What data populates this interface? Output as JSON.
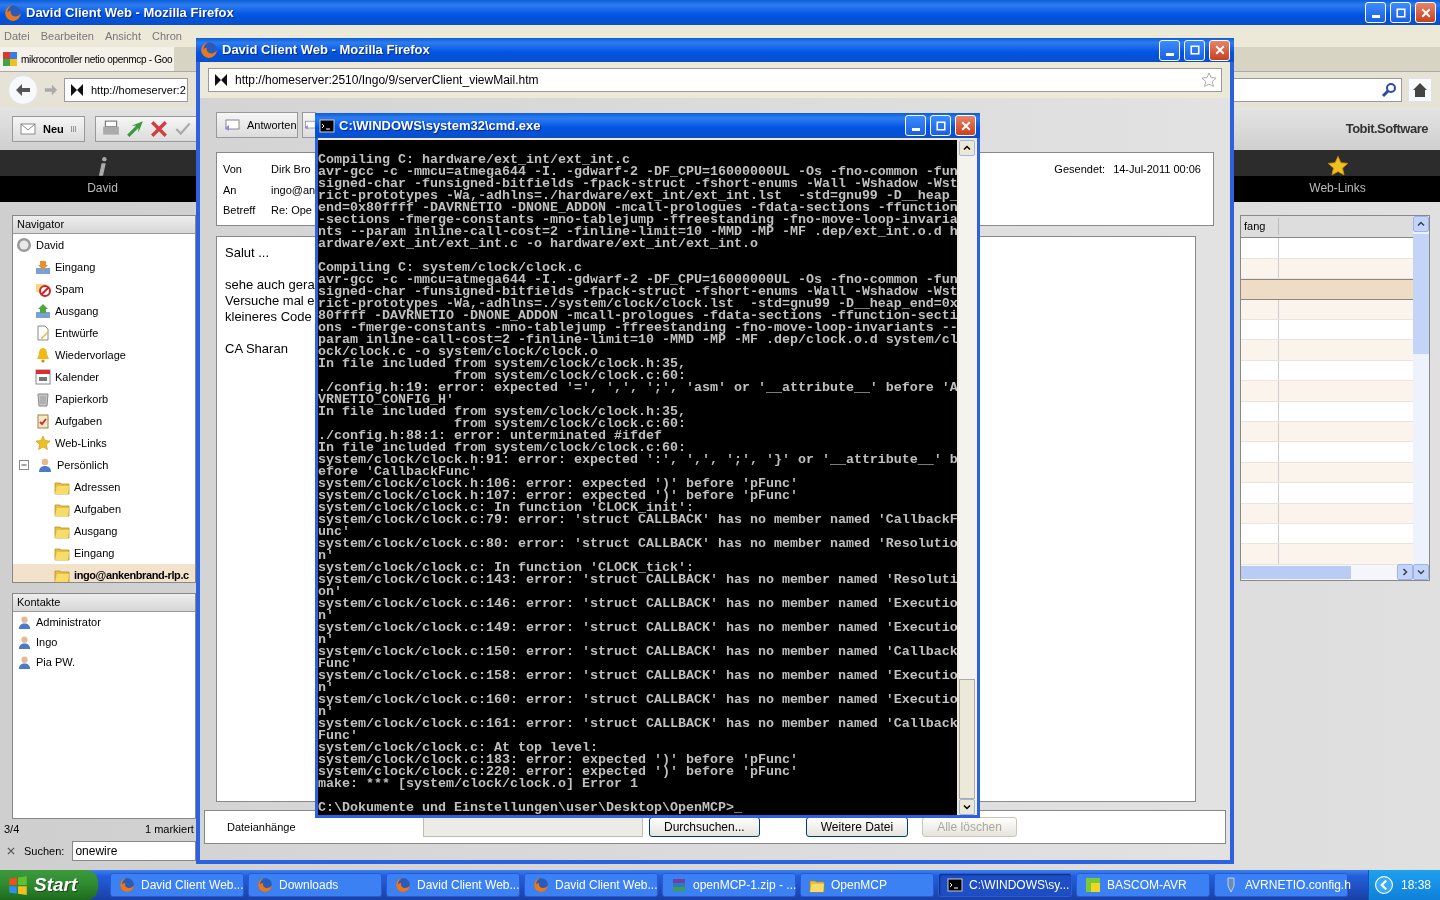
{
  "main_window": {
    "title": "David Client Web - Mozilla Firefox",
    "menu": [
      "Datei",
      "Bearbeiten",
      "Ansicht",
      "Chron"
    ],
    "tab": "mikrocontroller netio openmcp - Goo",
    "url": "http://homeserver:2",
    "new_button": "Neu",
    "logo": "Tobit.Software",
    "bands": [
      {
        "label": "David",
        "kind": "info"
      },
      {
        "label": "Web-Links",
        "kind": "star"
      }
    ],
    "navigator": {
      "title": "Navigator",
      "items": [
        {
          "label": "David",
          "kind": "david",
          "selected": false,
          "children": [
            {
              "label": "Eingang",
              "kind": "inbox",
              "selected": false
            },
            {
              "label": "Spam",
              "kind": "spam",
              "selected": false
            },
            {
              "label": "Ausgang",
              "kind": "outbox",
              "selected": false
            },
            {
              "label": "Entwürfe",
              "kind": "draft",
              "selected": false
            },
            {
              "label": "Wiedervorlage",
              "kind": "bell",
              "selected": false
            },
            {
              "label": "Kalender",
              "kind": "calendar",
              "selected": false
            },
            {
              "label": "Papierkorb",
              "kind": "trash",
              "selected": false
            },
            {
              "label": "Aufgaben",
              "kind": "tasks",
              "selected": false
            },
            {
              "label": "Web-Links",
              "kind": "star",
              "selected": false
            },
            {
              "label": "Persönlich",
              "kind": "person",
              "selected": false,
              "expanded": true,
              "children": [
                {
                  "label": "Adressen",
                  "kind": "folder",
                  "selected": false
                },
                {
                  "label": "Aufgaben",
                  "kind": "folder",
                  "selected": false
                },
                {
                  "label": "Ausgang",
                  "kind": "folder",
                  "selected": false
                },
                {
                  "label": "Eingang",
                  "kind": "folder",
                  "selected": false
                },
                {
                  "label": "ingo@ankenbrand-rlp.c",
                  "kind": "folder",
                  "selected": true
                }
              ]
            }
          ]
        }
      ]
    },
    "contacts": {
      "title": "Kontakte",
      "items": [
        "Administrator",
        "Ingo",
        "Pia PW."
      ]
    },
    "status": {
      "count": "3/4",
      "marked": "1 markiert"
    },
    "search": {
      "label": "Suchen:",
      "value": "onewire"
    },
    "grid": {
      "column": "fang",
      "rows": [
        {
          "selected": false
        },
        {
          "selected": false
        },
        {
          "selected": true
        },
        {
          "selected": false
        },
        {
          "selected": false
        },
        {
          "selected": false
        },
        {
          "selected": false
        },
        {
          "selected": false
        },
        {
          "selected": false
        },
        {
          "selected": false
        },
        {
          "selected": false
        },
        {
          "selected": false
        },
        {
          "selected": false
        },
        {
          "selected": false
        },
        {
          "selected": false
        },
        {
          "selected": false
        }
      ]
    }
  },
  "mail_window": {
    "title": "David Client Web - Mozilla Firefox",
    "url": "http://homeserver:2510/Ingo/9/serverClient_viewMail.htm",
    "reply_button": "Antworten",
    "fields": [
      {
        "label": "Von",
        "value": "Dirk Bro"
      },
      {
        "label": "An",
        "value": "ingo@an"
      },
      {
        "label": "Betreff",
        "value": "Re: Ope"
      }
    ],
    "sent_label": "Gesendet:",
    "sent": "14-Jul-2011 00:06",
    "body": [
      [
        "Salut ..."
      ],
      [
        "sehe auch gera",
        "Versuche mal e",
        "kleineres Code"
      ],
      [
        "CA Sharan"
      ]
    ],
    "attachments_label": "Dateianhänge",
    "buttons": [
      {
        "label": "Durchsuchen...",
        "disabled": false
      },
      {
        "label": "Weitere Datei",
        "disabled": false
      },
      {
        "label": "Alle löschen",
        "disabled": true
      }
    ]
  },
  "console": {
    "title": "C:\\WINDOWS\\system32\\cmd.exe",
    "blocks": [
      [
        "Compiling C: hardware/ext_int/ext_int.c",
        "avr-gcc -c -mmcu=atmega644 -I. -gdwarf-2 -DF_CPU=16000000UL -Os -fno-common -fun",
        "signed-char -funsigned-bitfields -fpack-struct -fshort-enums -Wall -Wshadow -Wst",
        "rict-prototypes -Wa,-adhlns=./hardware/ext_int/ext_int.lst  -std=gnu99 -D__heap_",
        "end=0x80ffff -DAVRNETIO -DNONE_ADDON -mcall-prologues -fdata-sections -ffunction",
        "-sections -fmerge-constants -mno-tablejump -ffreestanding -fno-move-loop-invaria",
        "nts --param inline-call-cost=2 -finline-limit=10 -MMD -MP -MF .dep/ext_int.o.d h",
        "ardware/ext_int/ext_int.c -o hardware/ext_int/ext_int.o"
      ],
      [
        "Compiling C: system/clock/clock.c",
        "avr-gcc -c -mmcu=atmega644 -I. -gdwarf-2 -DF_CPU=16000000UL -Os -fno-common -fun",
        "signed-char -funsigned-bitfields -fpack-struct -fshort-enums -Wall -Wshadow -Wst",
        "rict-prototypes -Wa,-adhlns=./system/clock/clock.lst  -std=gnu99 -D__heap_end=0x",
        "80ffff -DAVRNETIO -DNONE_ADDON -mcall-prologues -fdata-sections -ffunction-secti",
        "ons -fmerge-constants -mno-tablejump -ffreestanding -fno-move-loop-invariants --",
        "param inline-call-cost=2 -finline-limit=10 -MMD -MP -MF .dep/clock.o.d system/cl",
        "ock/clock.c -o system/clock/clock.o",
        "In file included from system/clock/clock.h:35,",
        "                 from system/clock/clock.c:60:",
        "./config.h:19: error: expected '=', ',', ';', 'asm' or '__attribute__' before 'A",
        "VRNETIO_CONFIG_H'",
        "In file included from system/clock/clock.h:35,",
        "                 from system/clock/clock.c:60:",
        "./config.h:88:1: error: unterminated #ifdef",
        "In file included from system/clock/clock.c:60:",
        "system/clock/clock.h:91: error: expected ':', ',', ';', '}' or '__attribute__' b",
        "efore 'CallbackFunc'",
        "system/clock/clock.h:106: error: expected ')' before 'pFunc'",
        "system/clock/clock.h:107: error: expected ')' before 'pFunc'",
        "system/clock/clock.c: In function 'CLOCK_init':",
        "system/clock/clock.c:79: error: 'struct CALLBACK' has no member named 'CallbackF",
        "unc'",
        "system/clock/clock.c:80: error: 'struct CALLBACK' has no member named 'Resolutio",
        "n'",
        "system/clock/clock.c: In function 'CLOCK_tick':",
        "system/clock/clock.c:143: error: 'struct CALLBACK' has no member named 'Resoluti",
        "on'",
        "system/clock/clock.c:146: error: 'struct CALLBACK' has no member named 'Executio",
        "n'",
        "system/clock/clock.c:149: error: 'struct CALLBACK' has no member named 'Executio",
        "n'",
        "system/clock/clock.c:150: error: 'struct CALLBACK' has no member named 'Callback",
        "Func'",
        "system/clock/clock.c:158: error: 'struct CALLBACK' has no member named 'Executio",
        "n'",
        "system/clock/clock.c:160: error: 'struct CALLBACK' has no member named 'Executio",
        "n'",
        "system/clock/clock.c:161: error: 'struct CALLBACK' has no member named 'Callback",
        "Func'",
        "system/clock/clock.c: At top level:",
        "system/clock/clock.c:183: error: expected ')' before 'pFunc'",
        "system/clock/clock.c:220: error: expected ')' before 'pFunc'",
        "make: *** [system/clock/clock.o] Error 1"
      ],
      [
        "C:\\Dokumente und Einstellungen\\user\\Desktop\\OpenMCP>_"
      ]
    ]
  },
  "taskbar": {
    "start": "Start",
    "tasks": [
      {
        "label": "David Client Web...",
        "kind": "firefox",
        "selected": false
      },
      {
        "label": "Downloads",
        "kind": "firefox",
        "selected": false
      },
      {
        "label": "David Client Web...",
        "kind": "firefox",
        "selected": false
      },
      {
        "label": "David Client Web...",
        "kind": "firefox",
        "selected": false
      },
      {
        "label": "openMCP-1.zip - ...",
        "kind": "archive",
        "selected": false
      },
      {
        "label": "OpenMCP",
        "kind": "folder",
        "selected": false
      },
      {
        "label": "C:\\WINDOWS\\sy...",
        "kind": "cmd",
        "selected": true
      },
      {
        "label": "BASCOM-AVR",
        "kind": "bascom",
        "selected": false
      },
      {
        "label": "AVRNETIO.config.h",
        "kind": "pen",
        "selected": false
      }
    ],
    "clock": "18:38"
  }
}
